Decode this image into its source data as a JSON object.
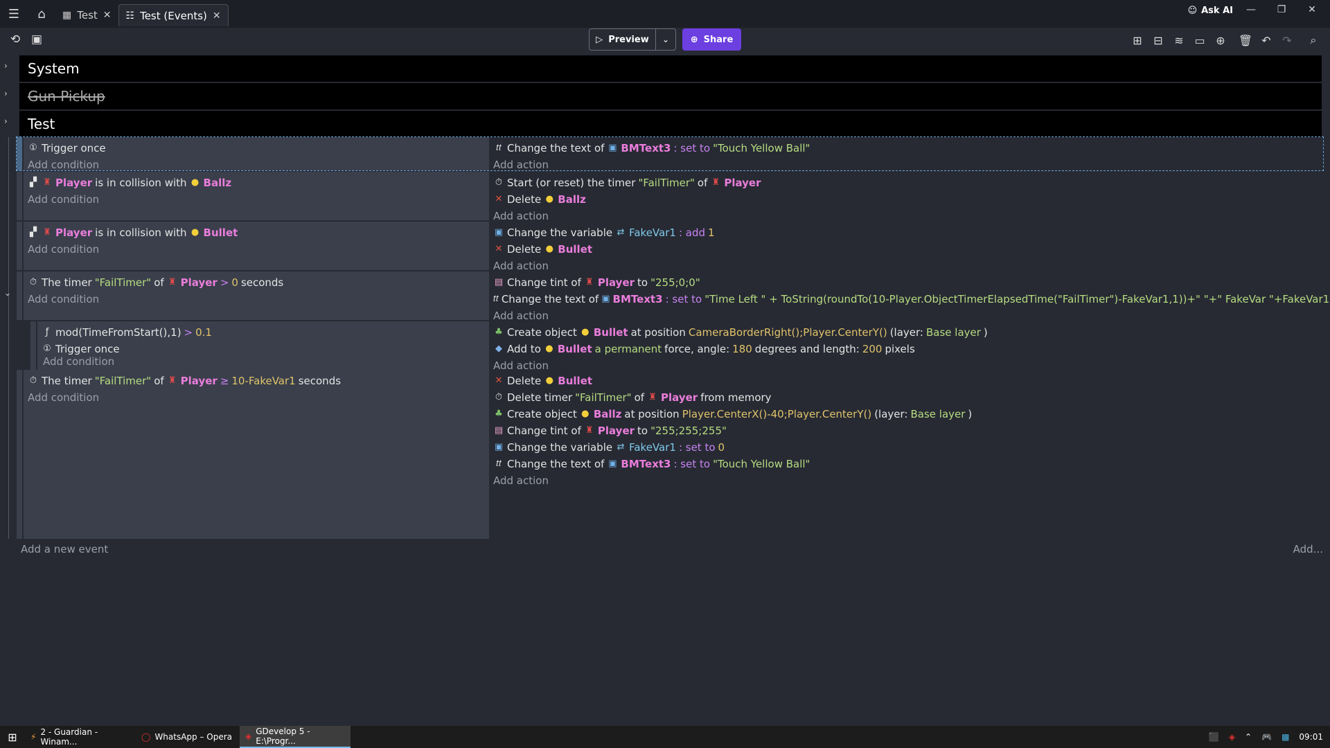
{
  "tabs": [
    {
      "label": "Test",
      "icon": "scene-icon"
    },
    {
      "label": "Test (Events)",
      "icon": "events-icon"
    }
  ],
  "ask_ai": "Ask AI",
  "toolbar": {
    "preview": "Preview",
    "share": "Share"
  },
  "groups": [
    {
      "label": "System",
      "disabled": false
    },
    {
      "label": "Gun Pickup",
      "disabled": true
    },
    {
      "label": "Test",
      "disabled": false
    }
  ],
  "common": {
    "add_condition": "Add condition",
    "add_action": "Add action"
  },
  "ev1": {
    "c1": "Trigger once",
    "a1": {
      "pre": "Change the text of",
      "obj": "BMText3",
      "op": ": set to",
      "val": "\"Touch Yellow Ball\""
    }
  },
  "ev2": {
    "c1": {
      "obj": "Player",
      "mid": "is in collision with",
      "obj2": "Ballz"
    },
    "a1": {
      "pre": "Start (or reset) the timer",
      "str": "\"FailTimer\"",
      "of": "of",
      "obj": "Player"
    },
    "a2": {
      "pre": "Delete",
      "obj": "Ballz"
    }
  },
  "ev3": {
    "c1": {
      "obj": "Player",
      "mid": "is in collision with",
      "obj2": "Bullet"
    },
    "a1": {
      "pre": "Change the variable",
      "var": "FakeVar1",
      "op": ": add",
      "val": "1"
    },
    "a2": {
      "pre": "Delete",
      "obj": "Bullet"
    }
  },
  "ev4": {
    "c1": {
      "pre": "The timer",
      "str": "\"FailTimer\"",
      "of": "of",
      "obj": "Player",
      "op": ">",
      "val": "0",
      "post": "seconds"
    },
    "a1": {
      "pre": "Change tint of",
      "obj": "Player",
      "to": "to",
      "val": "\"255;0;0\""
    },
    "a2": {
      "pre": "Change the text of",
      "obj": "BMText3",
      "op": ": set to",
      "val": "\"Time Left \" + ToString(roundTo(10-Player.ObjectTimerElapsedTime(\"FailTimer\")-FakeVar1,1))+\" \"+\" FakeVar \"+FakeVar1"
    }
  },
  "ev5": {
    "c1": {
      "expr": "mod(TimeFromStart(),1)",
      "op": ">",
      "val": "0.1"
    },
    "c2": "Trigger once",
    "a1": {
      "pre": "Create object",
      "obj": "Bullet",
      "mid": "at position",
      "pos": "CameraBorderRight();Player.CenterY()",
      "layer_pre": "(layer:",
      "layer": "Base layer",
      "layer_post": ")"
    },
    "a2": {
      "pre": "Add to",
      "obj": "Bullet",
      "kind": "a permanent",
      "mid": "force, angle:",
      "angle": "180",
      "mid2": "degrees and length:",
      "len": "200",
      "post": "pixels"
    }
  },
  "ev6": {
    "c1": {
      "pre": "The timer",
      "str": "\"FailTimer\"",
      "of": "of",
      "obj": "Player",
      "op": "≥",
      "val": "10-FakeVar1",
      "post": "seconds"
    },
    "a1": {
      "pre": "Delete",
      "obj": "Bullet"
    },
    "a2": {
      "pre": "Delete timer",
      "str": "\"FailTimer\"",
      "of": "of",
      "obj": "Player",
      "post": "from memory"
    },
    "a3": {
      "pre": "Create object",
      "obj": "Ballz",
      "mid": "at position",
      "pos": "Player.CenterX()-40;Player.CenterY()",
      "layer_pre": "(layer:",
      "layer": "Base layer",
      "layer_post": ")"
    },
    "a4": {
      "pre": "Change tint of",
      "obj": "Player",
      "to": "to",
      "val": "\"255;255;255\""
    },
    "a5": {
      "pre": "Change the variable",
      "var": "FakeVar1",
      "op": ": set to",
      "val": "0"
    },
    "a6": {
      "pre": "Change the text of",
      "obj": "BMText3",
      "op": ": set to",
      "val": "\"Touch Yellow Ball\""
    }
  },
  "add_event": "Add a new event",
  "add_more": "Add...",
  "taskbar": {
    "items": [
      "2 - Guardian - Winam...",
      "WhatsApp – Opera",
      "GDevelop 5 - E:\\Progr..."
    ],
    "clock": "09:01"
  }
}
